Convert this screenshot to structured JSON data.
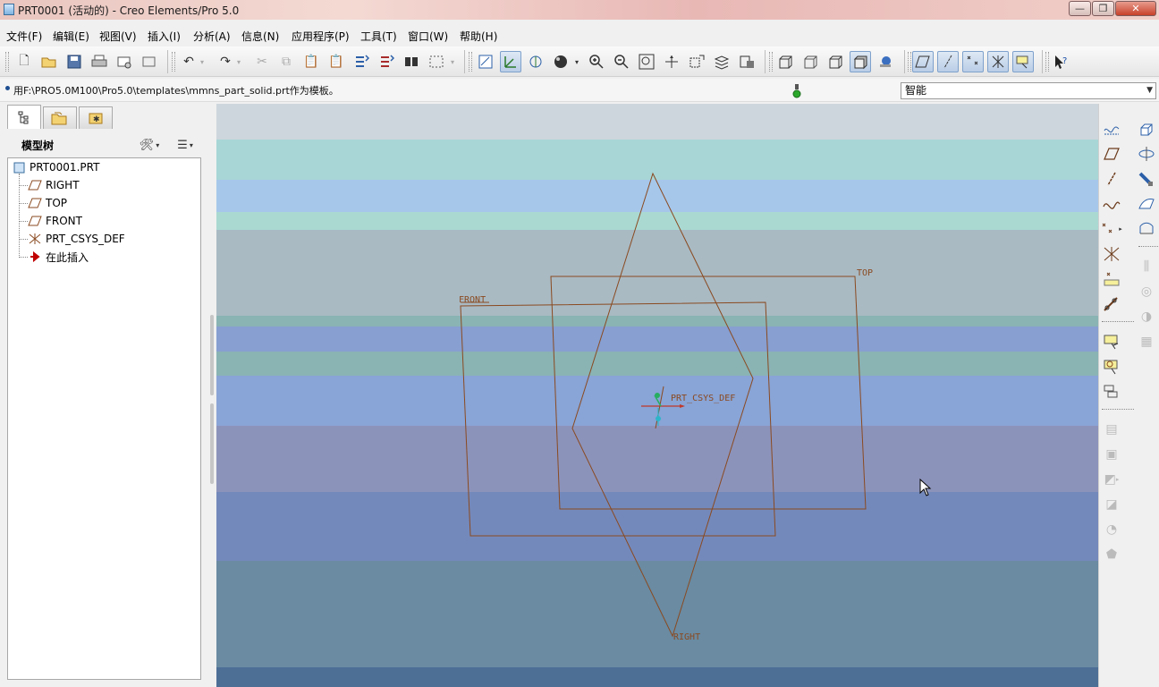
{
  "window": {
    "title": "PRT0001 (活动的) - Creo Elements/Pro 5.0",
    "minimize_label": "—",
    "restore_label": "❐",
    "close_label": "✕"
  },
  "menubar": {
    "items": [
      "文件(F)",
      "编辑(E)",
      "视图(V)",
      "插入(I)",
      "分析(A)",
      "信息(N)",
      "应用程序(P)",
      "工具(T)",
      "窗口(W)",
      "帮助(H)"
    ]
  },
  "toolbar": {
    "icons": [
      "new-file-icon",
      "open-file-icon",
      "save-icon",
      "print-icon",
      "send-mail-icon",
      "undo-icon",
      "redo-icon",
      "cut-icon",
      "copy-icon",
      "paste-icon",
      "regenerate-icon",
      "find-icon",
      "select-box-icon",
      "repaint-icon",
      "orient-icon",
      "zoom-in-icon",
      "zoom-out-icon",
      "refit-icon",
      "saved-views-icon",
      "layers-icon",
      "wireframe-icon",
      "hidden-line-icon",
      "no-hidden-icon",
      "shading-icon",
      "datum-planes-icon",
      "datum-axes-icon",
      "datum-points-icon",
      "coord-sys-icon",
      "annotation-icon",
      "whats-this-icon"
    ]
  },
  "message": {
    "text": "用F:\\PRO5.0M100\\Pro5.0\\templates\\mmns_part_solid.prt作为模板。"
  },
  "filter": {
    "value": "智能"
  },
  "navigator": {
    "tabs": [
      "model-tree-tab",
      "folder-browser-tab",
      "favorites-tab"
    ],
    "tree_title": "模型树",
    "tree": {
      "root": "PRT0001.PRT",
      "items": [
        {
          "label": "RIGHT",
          "icon": "datum-plane-icon"
        },
        {
          "label": "TOP",
          "icon": "datum-plane-icon"
        },
        {
          "label": "FRONT",
          "icon": "datum-plane-icon"
        },
        {
          "label": "PRT_CSYS_DEF",
          "icon": "coordinate-system-icon"
        },
        {
          "label": "在此插入",
          "icon": "insert-here-arrow-icon"
        }
      ]
    }
  },
  "graphics": {
    "plane_labels": {
      "top": "TOP",
      "front": "FRONT",
      "right": "RIGHT",
      "csys": "PRT_CSYS_DEF"
    },
    "plane_color": "#8a4a20",
    "band_colors": [
      "#cdd6dc",
      "#a8d6d6",
      "#a6c7ea",
      "#aad9d2",
      "#a9bac3",
      "#8ab3b4",
      "#879fd1",
      "#8ab3b4",
      "#89a4d6",
      "#8c93bb",
      "#7489bb",
      "#6a8ba2",
      "#4d6f96"
    ]
  },
  "rightbar": {
    "icons": [
      "sketch-icon",
      "datum-plane-tool-icon",
      "datum-axis-tool-icon",
      "datum-curve-icon",
      "datum-point-icon",
      "coord-sys-tool-icon",
      "analysis-feature-icon",
      "sketch-tool-icon",
      "note-icon",
      "annotation-feature-icon",
      "sketched-feature-icon",
      "hole-icon",
      "shell-icon",
      "rib-icon",
      "draft-icon",
      "round-icon",
      "chamfer-icon",
      "extrude-icon",
      "revolve-icon",
      "sweep-icon",
      "blend-icon",
      "boundary-icon",
      "mirror-icon",
      "merge-icon",
      "trim-icon",
      "pattern-icon"
    ]
  }
}
